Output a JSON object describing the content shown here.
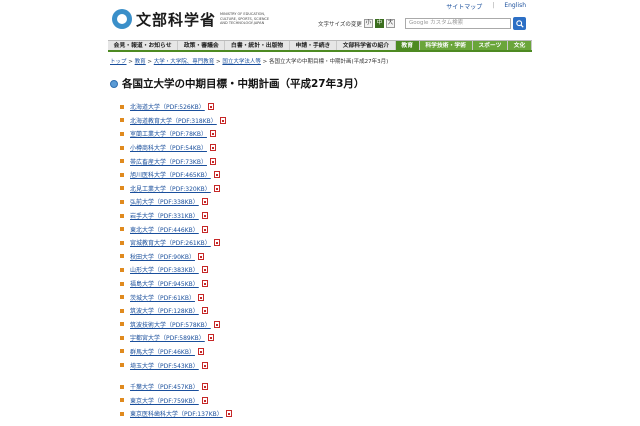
{
  "header": {
    "logo_text": "文部科学省",
    "logo_sub": "MINISTRY OF EDUCATION, CULTURE, SPORTS, SCIENCE AND TECHNOLOGY-JAPAN",
    "top_links": [
      "サイトマップ",
      "English"
    ],
    "font_size_label": "文字サイズの変更",
    "font_sizes": [
      "小",
      "中",
      "大"
    ],
    "search_placeholder": "Google カスタム検索"
  },
  "nav": {
    "items": [
      "会見・報道・お知らせ",
      "政策・審議会",
      "白書・統計・出版物",
      "申請・手続き",
      "文部科学省の紹介",
      "教育",
      "科学技術・学術",
      "スポーツ",
      "文化"
    ],
    "active_index": 5
  },
  "breadcrumb": {
    "items": [
      "トップ",
      "教育",
      "大学・大学院、専門教育",
      "国立大学法人等"
    ],
    "current": "各国立大学の中期目標・中期計画(平成27年3月)"
  },
  "page_title": "各国立大学の中期目標・中期計画（平成27年3月）",
  "colors": {
    "nav_active": "#4d8a22",
    "link": "#1a4f9c",
    "bullet": "#e08a1e"
  },
  "universities": [
    {
      "name": "北海道大学",
      "size": "（PDF:526KB）"
    },
    {
      "name": "北海道教育大学",
      "size": "（PDF:318KB）"
    },
    {
      "name": "室蘭工業大学",
      "size": "（PDF:78KB）"
    },
    {
      "name": "小樽商科大学",
      "size": "（PDF:54KB）"
    },
    {
      "name": "帯広畜産大学",
      "size": "（PDF:73KB）"
    },
    {
      "name": "旭川医科大学",
      "size": "（PDF:465KB）"
    },
    {
      "name": "北見工業大学",
      "size": "（PDF:320KB）"
    },
    {
      "name": "弘前大学",
      "size": "（PDF:338KB）"
    },
    {
      "name": "岩手大学",
      "size": "（PDF:331KB）"
    },
    {
      "name": "東北大学",
      "size": "（PDF:446KB）"
    },
    {
      "name": "宮城教育大学",
      "size": "（PDF:261KB）"
    },
    {
      "name": "秋田大学",
      "size": "（PDF:90KB）"
    },
    {
      "name": "山形大学",
      "size": "（PDF:383KB）"
    },
    {
      "name": "福島大学",
      "size": "（PDF:945KB）"
    },
    {
      "name": "茨城大学",
      "size": "（PDF:61KB）"
    },
    {
      "name": "筑波大学",
      "size": "（PDF:128KB）"
    },
    {
      "name": "筑波技術大学",
      "size": "（PDF:578KB）"
    },
    {
      "name": "宇都宮大学",
      "size": "（PDF:589KB）"
    },
    {
      "name": "群馬大学",
      "size": "（PDF:46KB）"
    },
    {
      "name": "埼玉大学",
      "size": "（PDF:543KB）"
    },
    {
      "name": "千葉大学",
      "size": "（PDF:457KB）"
    },
    {
      "name": "東京大学",
      "size": "（PDF:759KB）"
    },
    {
      "name": "東京医科歯科大学",
      "size": "（PDF:137KB）"
    }
  ],
  "group_break_index": 20
}
